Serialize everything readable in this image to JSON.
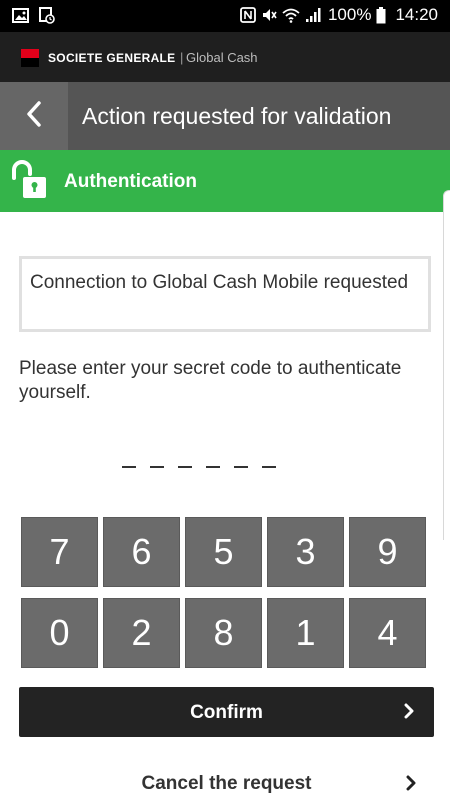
{
  "status_bar": {
    "icons_left": [
      "image-icon",
      "alarm-icon"
    ],
    "icons_right": [
      "nfc-icon",
      "mute-icon",
      "wifi-icon",
      "signal-icon"
    ],
    "battery": "100%",
    "time": "14:20"
  },
  "brand": {
    "name": "SOCIETE GENERALE",
    "separator": "|",
    "product": "Global Cash",
    "logo_colors": [
      "#e2001a",
      "#000000"
    ]
  },
  "header": {
    "title": "Action requested for validation",
    "back_icon": "chevron-left-icon"
  },
  "auth": {
    "title": "Authentication",
    "icon": "lock-open-icon",
    "color": "#34b44a"
  },
  "message": "Connection to Global Cash Mobile requested",
  "instruction": "Please enter your secret code to authenticate yourself.",
  "code": {
    "slots": [
      "",
      "",
      "",
      "",
      "",
      ""
    ]
  },
  "keypad": {
    "keys": [
      "7",
      "6",
      "5",
      "3",
      "9",
      "0",
      "2",
      "8",
      "1",
      "4"
    ]
  },
  "actions": {
    "confirm_label": "Confirm",
    "cancel_label": "Cancel the request"
  }
}
